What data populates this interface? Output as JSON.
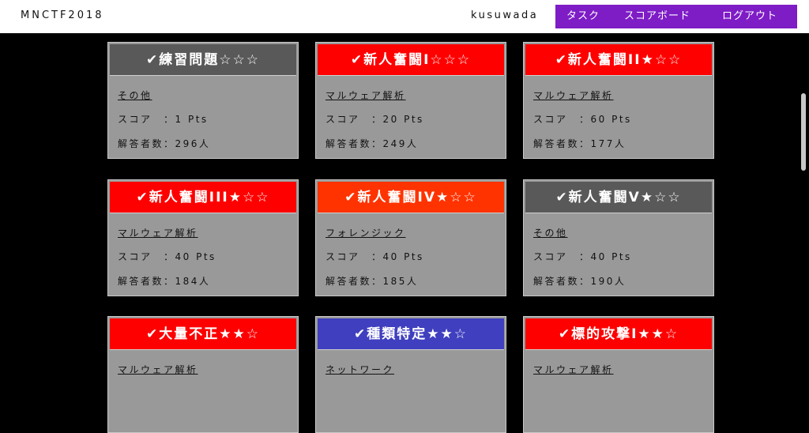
{
  "header": {
    "brand": "MNCTF2018",
    "username": "kusuwada",
    "nav": [
      {
        "label": "タスク"
      },
      {
        "label": "スコアボード"
      },
      {
        "label": "ログアウト"
      }
    ]
  },
  "labels": {
    "score": "スコア　：",
    "solvers": "解答者数："
  },
  "colors": {
    "solved_gray": "#595959",
    "red": "#ff0000",
    "orange": "#ff3300",
    "blue": "#3f3fbf",
    "nav_purple": "#7e1cc6"
  },
  "cards": [
    {
      "title": "✔練習問題☆☆☆",
      "head_color": "#595959",
      "category": "その他",
      "score": "1 Pts",
      "solvers": "296人"
    },
    {
      "title": "✔新人奮闘I☆☆☆",
      "head_color": "#ff0000",
      "category": "マルウェア解析",
      "score": "20 Pts",
      "solvers": "249人"
    },
    {
      "title": "✔新人奮闘II★☆☆",
      "head_color": "#ff0000",
      "category": "マルウェア解析",
      "score": "60 Pts",
      "solvers": "177人"
    },
    {
      "title": "✔新人奮闘III★☆☆",
      "head_color": "#ff0000",
      "category": "マルウェア解析",
      "score": "40 Pts",
      "solvers": "184人"
    },
    {
      "title": "✔新人奮闘IV★☆☆",
      "head_color": "#ff3300",
      "category": "フォレンジック",
      "score": "40 Pts",
      "solvers": "185人"
    },
    {
      "title": "✔新人奮闘V★☆☆",
      "head_color": "#595959",
      "category": "その他",
      "score": "40 Pts",
      "solvers": "190人"
    },
    {
      "title": "✔大量不正★★☆",
      "head_color": "#ff0000",
      "category": "マルウェア解析",
      "score": "",
      "solvers": ""
    },
    {
      "title": "✔種類特定★★☆",
      "head_color": "#3f3fbf",
      "category": "ネットワーク",
      "score": "",
      "solvers": ""
    },
    {
      "title": "✔標的攻撃I★★☆",
      "head_color": "#ff0000",
      "category": "マルウェア解析",
      "score": "",
      "solvers": ""
    }
  ]
}
